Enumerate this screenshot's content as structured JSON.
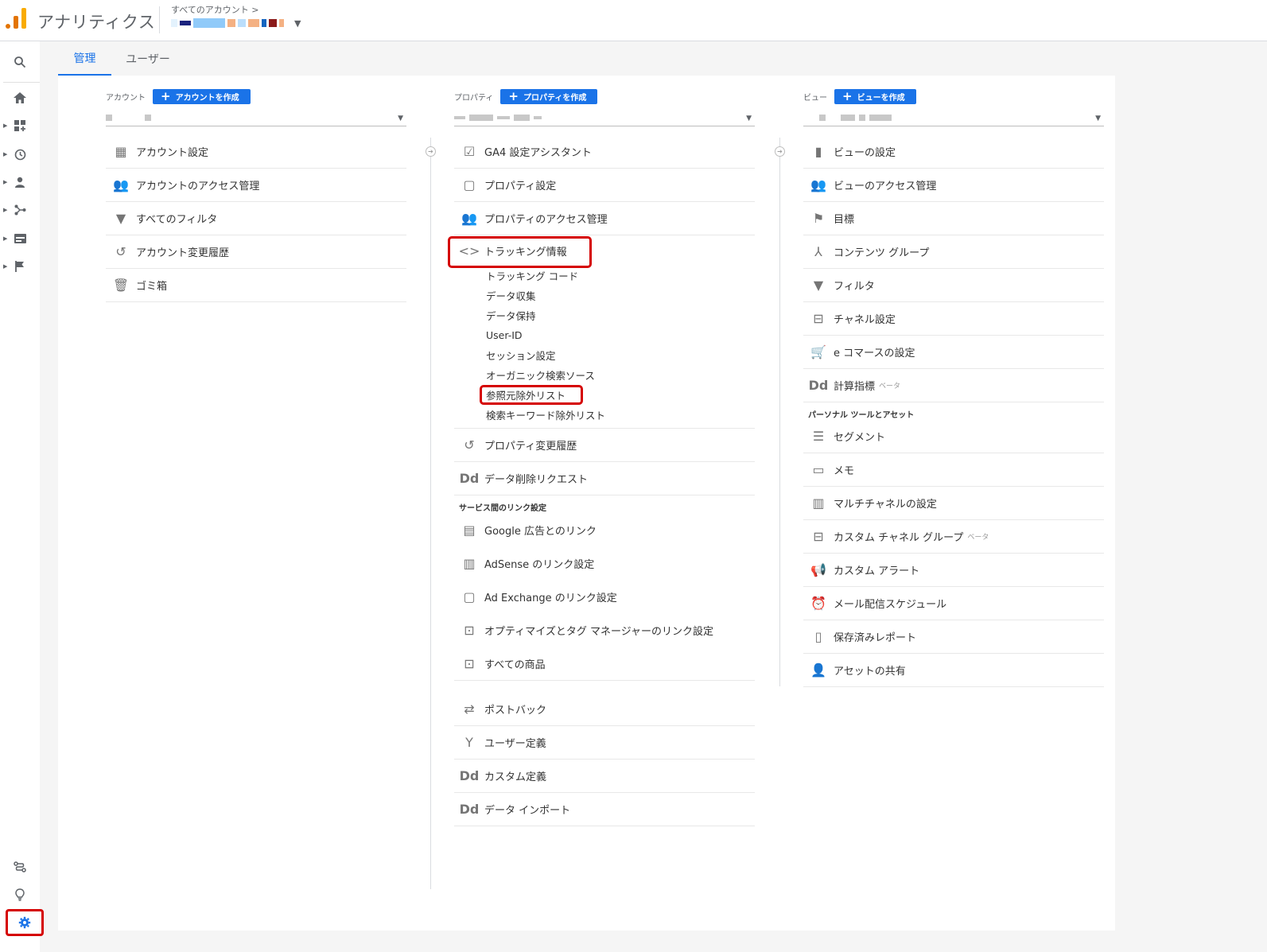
{
  "header": {
    "app_title": "アナリティクス",
    "breadcrumb": "すべてのアカウント > "
  },
  "tabs": [
    {
      "label": "管理",
      "active": true
    },
    {
      "label": "ユーザー",
      "active": false
    }
  ],
  "account": {
    "label": "アカウント",
    "create_label": "アカウントを作成",
    "items": [
      {
        "icon": "building-icon",
        "glyph": "▦",
        "label": "アカウント設定"
      },
      {
        "icon": "people-icon",
        "glyph": "👥",
        "label": "アカウントのアクセス管理"
      },
      {
        "icon": "filter-icon",
        "glyph": "▼",
        "label": "すべてのフィルタ"
      },
      {
        "icon": "history-icon",
        "glyph": "↺",
        "label": "アカウント変更履歴"
      },
      {
        "icon": "trash-icon",
        "glyph": "🗑",
        "label": "ゴミ箱"
      }
    ]
  },
  "property": {
    "label": "プロパティ",
    "create_label": "プロパティを作成",
    "items": [
      {
        "icon": "checkbox-icon",
        "glyph": "☑",
        "label": "GA4 設定アシスタント"
      },
      {
        "icon": "layout-icon",
        "glyph": "▢",
        "label": "プロパティ設定"
      },
      {
        "icon": "people-icon",
        "glyph": "👥",
        "label": "プロパティのアクセス管理"
      }
    ],
    "tracking": {
      "icon": "code-icon",
      "glyph": "<>",
      "label": "トラッキング情報",
      "subitems": [
        "トラッキング コード",
        "データ収集",
        "データ保持",
        "User-ID",
        "セッション設定",
        "オーガニック検索ソース",
        "参照元除外リスト",
        "検索キーワード除外リスト"
      ]
    },
    "items_after": [
      {
        "icon": "history-icon",
        "glyph": "↺",
        "label": "プロパティ変更履歴"
      },
      {
        "icon": "dd-icon",
        "glyph": "Dd",
        "label": "データ削除リクエスト"
      }
    ],
    "service_section_title": "サービス間のリンク設定",
    "service_items": [
      {
        "icon": "ads-icon",
        "glyph": "▤",
        "label": "Google 広告とのリンク"
      },
      {
        "icon": "adsense-icon",
        "glyph": "▥",
        "label": "AdSense のリンク設定"
      },
      {
        "icon": "adexchange-icon",
        "glyph": "▢",
        "label": "Ad Exchange のリンク設定"
      },
      {
        "icon": "optimize-icon",
        "glyph": "⊡",
        "label": "オプティマイズとタグ マネージャーのリンク設定"
      },
      {
        "icon": "products-icon",
        "glyph": "⊡",
        "label": "すべての商品"
      }
    ],
    "bottom_items": [
      {
        "icon": "postback-icon",
        "glyph": "⇄",
        "label": "ポストバック"
      },
      {
        "icon": "user-definition-icon",
        "glyph": "Y",
        "label": "ユーザー定義"
      },
      {
        "icon": "dd-icon",
        "glyph": "Dd",
        "label": "カスタム定義"
      },
      {
        "icon": "dd-icon",
        "glyph": "Dd",
        "label": "データ インポート"
      }
    ]
  },
  "view": {
    "label": "ビュー",
    "create_label": "ビューを作成",
    "items": [
      {
        "icon": "document-icon",
        "glyph": "▮",
        "label": "ビューの設定",
        "beta": ""
      },
      {
        "icon": "people-icon",
        "glyph": "👥",
        "label": "ビューのアクセス管理",
        "beta": ""
      },
      {
        "icon": "flag-icon",
        "glyph": "⚑",
        "label": "目標",
        "beta": ""
      },
      {
        "icon": "content-group-icon",
        "glyph": "⅄",
        "label": "コンテンツ グループ",
        "beta": ""
      },
      {
        "icon": "filter-icon",
        "glyph": "▼",
        "label": "フィルタ",
        "beta": ""
      },
      {
        "icon": "channel-icon",
        "glyph": "⊟",
        "label": "チャネル設定",
        "beta": ""
      },
      {
        "icon": "cart-icon",
        "glyph": "🛒",
        "label": "e コマースの設定",
        "beta": ""
      },
      {
        "icon": "dd-icon",
        "glyph": "Dd",
        "label": "計算指標",
        "beta": "ベータ"
      }
    ],
    "personal_section_title": "パーソナル ツールとアセット",
    "personal_items": [
      {
        "icon": "segment-icon",
        "glyph": "☰",
        "label": "セグメント",
        "beta": ""
      },
      {
        "icon": "memo-icon",
        "glyph": "▭",
        "label": "メモ",
        "beta": ""
      },
      {
        "icon": "multichannel-icon",
        "glyph": "▥",
        "label": "マルチチャネルの設定",
        "beta": ""
      },
      {
        "icon": "custom-channel-icon",
        "glyph": "⊟",
        "label": "カスタム チャネル グループ",
        "beta": "ベータ"
      },
      {
        "icon": "megaphone-icon",
        "glyph": "📢",
        "label": "カスタム アラート",
        "beta": ""
      },
      {
        "icon": "alarm-icon",
        "glyph": "⏰",
        "label": "メール配信スケジュール",
        "beta": ""
      },
      {
        "icon": "saved-report-icon",
        "glyph": "▯",
        "label": "保存済みレポート",
        "beta": ""
      },
      {
        "icon": "share-assets-icon",
        "glyph": "👤",
        "label": "アセットの共有",
        "beta": ""
      }
    ]
  },
  "colors": {
    "accent": "#1a73e8",
    "highlight": "#d50000"
  }
}
